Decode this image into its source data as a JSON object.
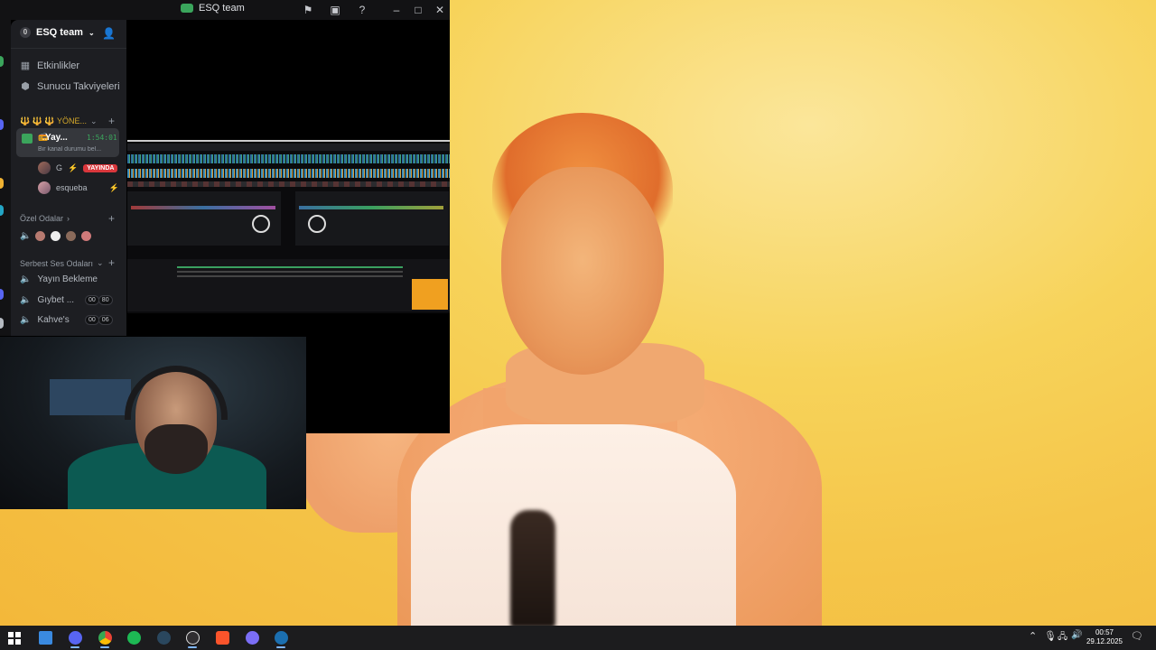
{
  "window": {
    "title": "ESQ team"
  },
  "server": {
    "badge": "0",
    "name": "ESQ team",
    "nav": [
      {
        "label": "Etkinlikler",
        "icon": "calendar-icon"
      },
      {
        "label": "Sunucu Takviyeleri",
        "icon": "boost-icon"
      }
    ]
  },
  "categories": {
    "staff": "🔱 🔱 🔱 YÖNE...",
    "private": "Özel Odalar",
    "free_voice": "Serbest Ses Odaları"
  },
  "active_channel": {
    "name": "Yay...",
    "timer": "1:54:01",
    "status": "Bir kanal durumu bel..."
  },
  "users": [
    {
      "name": "G",
      "badge": "YAYINDA"
    },
    {
      "name": "esqueba",
      "badge": ""
    }
  ],
  "voice_channels": [
    {
      "name": "Yayın Bekleme",
      "count_a": "",
      "count_b": ""
    },
    {
      "name": "Gıybet ...",
      "count_a": "00",
      "count_b": "80"
    },
    {
      "name": "Kahve's",
      "count_a": "00",
      "count_b": "06"
    }
  ],
  "taskbar": {
    "apps": [
      "explorer",
      "discord",
      "chrome",
      "spotify",
      "steam",
      "obs",
      "brave",
      "discord-2",
      "steam-2"
    ],
    "time": "00:57",
    "date": "29.12.2025"
  },
  "colors": {
    "discord_green": "#3ba55c",
    "live_red": "#da373c",
    "sidebar_bg": "#1d1e22"
  }
}
